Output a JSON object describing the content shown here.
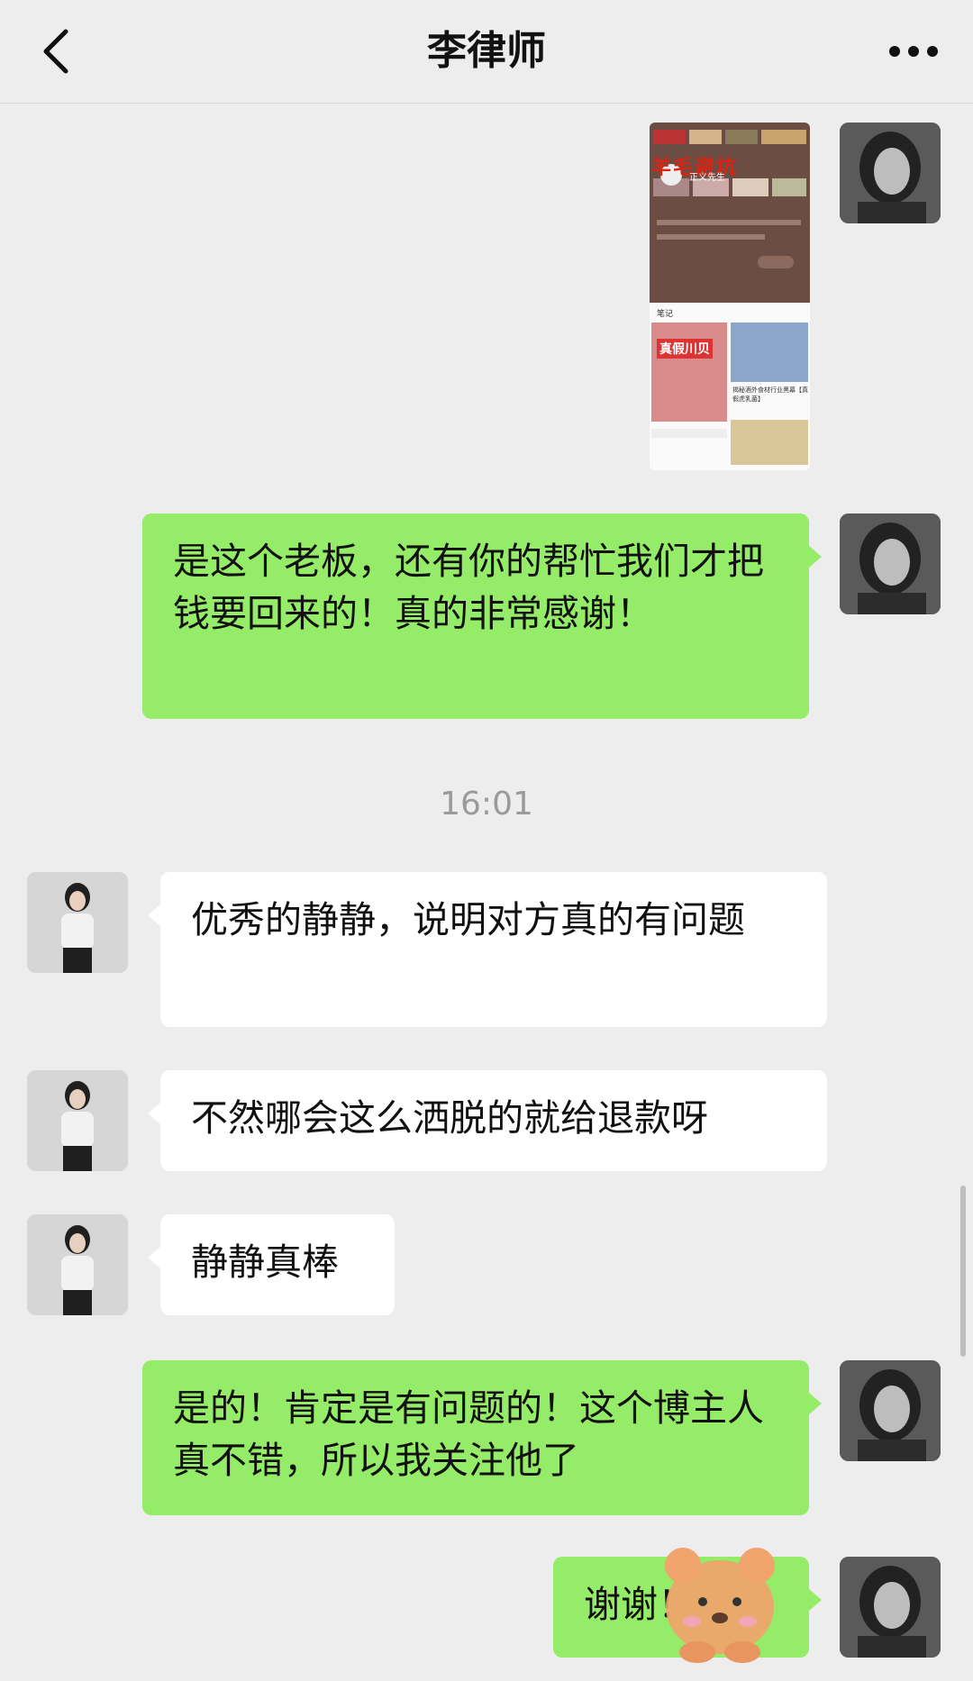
{
  "header": {
    "title": "李律师",
    "back_icon": "chevron-left-icon",
    "more_icon": "more-dots-icon"
  },
  "messages": [
    {
      "side": "right",
      "type": "image",
      "image_caption": "羊毛避坑",
      "image_author": "正义先生",
      "image_tab": "笔记",
      "image_tag": "真假川贝",
      "image_note_title": "揭秘酒外食材行业黑幕【真假虎乳菌】"
    },
    {
      "side": "right",
      "type": "text",
      "text": "是这个老板，还有你的帮忙我们才把钱要回来的！真的非常感谢！"
    },
    {
      "type": "time",
      "text": "16:01"
    },
    {
      "side": "left",
      "type": "text",
      "text": "优秀的静静，说明对方真的有问题"
    },
    {
      "side": "left",
      "type": "text",
      "text": "不然哪会这么洒脱的就给退款呀"
    },
    {
      "side": "left",
      "type": "text",
      "text": "静静真棒"
    },
    {
      "side": "right",
      "type": "text",
      "text": "是的！肯定是有问题的！这个博主人真不错，所以我关注他了"
    },
    {
      "side": "right",
      "type": "text",
      "text": "谢谢！"
    }
  ],
  "colors": {
    "background": "#ededed",
    "sent_bubble": "#95ec69",
    "received_bubble": "#ffffff"
  }
}
